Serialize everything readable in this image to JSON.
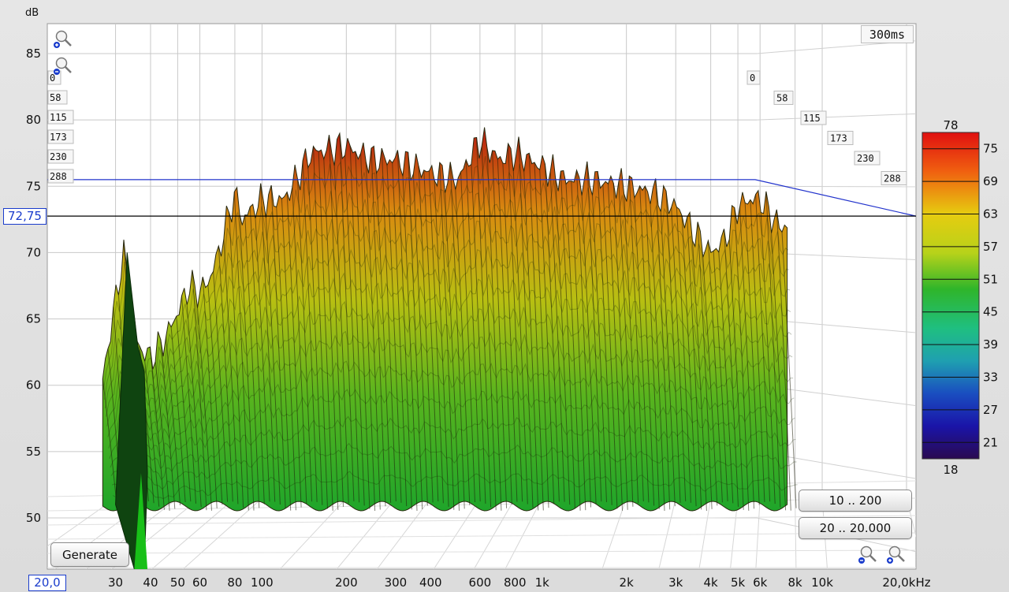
{
  "chart_data": {
    "type": "area",
    "ylabel": "dB",
    "xlabel": "",
    "y_ticks": [
      "85",
      "80",
      "75",
      "70",
      "65",
      "60",
      "55",
      "50"
    ],
    "y_tick_values": [
      85,
      80,
      75,
      70,
      65,
      60,
      55,
      50
    ],
    "ylim": [
      47,
      87
    ],
    "x_tick_labels": [
      "30",
      "40",
      "50",
      "60",
      "80",
      "100",
      "200",
      "300",
      "400",
      "600",
      "800",
      "1k",
      "2k",
      "3k",
      "4k",
      "5k",
      "6k",
      "8k",
      "10k",
      "20,0kHz"
    ],
    "x_tick_values": [
      30,
      40,
      50,
      60,
      80,
      100,
      200,
      300,
      400,
      600,
      800,
      1000,
      2000,
      3000,
      4000,
      5000,
      6000,
      8000,
      10000,
      20000
    ],
    "xlim": [
      20,
      20000
    ],
    "x_scale": "log",
    "x_start_label": "20,0",
    "time_axis_ms": [
      "0",
      "58",
      "115",
      "173",
      "230",
      "288"
    ],
    "time_span": "300ms",
    "cursor_level_label": "72,75",
    "cursor_level": 72.75,
    "threshold_level": 75.5,
    "colorbar": {
      "max_label": "78",
      "min_label": "18",
      "ticks": [
        "75",
        "69",
        "63",
        "57",
        "51",
        "45",
        "39",
        "33",
        "27",
        "21"
      ],
      "tick_values": [
        75,
        69,
        63,
        57,
        51,
        45,
        39,
        33,
        27,
        21
      ],
      "range": [
        18,
        78
      ]
    },
    "surface_envelope": {
      "description_points_hz": [
        27,
        32,
        36,
        40,
        45,
        50,
        55,
        60,
        65,
        70,
        80,
        85,
        100,
        120,
        150,
        200,
        220,
        250,
        300,
        400,
        500,
        600,
        700,
        800,
        1000,
        1200,
        1500,
        2000,
        2500,
        3000,
        3500,
        4000,
        4500,
        5000,
        5500,
        6000,
        7000
      ],
      "peak_db": [
        60.5,
        70,
        63,
        62,
        63.5,
        65.5,
        67.5,
        67,
        68,
        70,
        74.5,
        72.5,
        74,
        74,
        77.5,
        78,
        77.5,
        77,
        77,
        76,
        75.5,
        78.5,
        77,
        77.5,
        76.5,
        75.5,
        75.5,
        75,
        74.5,
        73.5,
        71.5,
        70,
        71,
        73.5,
        74,
        74,
        72
      ]
    },
    "grid": true,
    "colors": {
      "threshold_line": "#2233cc",
      "cursor_line": "#000000"
    }
  },
  "controls": {
    "generate_label": "Generate",
    "freq_range_label": "20 .. 20.000",
    "db_range_label": "10 .. 200"
  }
}
